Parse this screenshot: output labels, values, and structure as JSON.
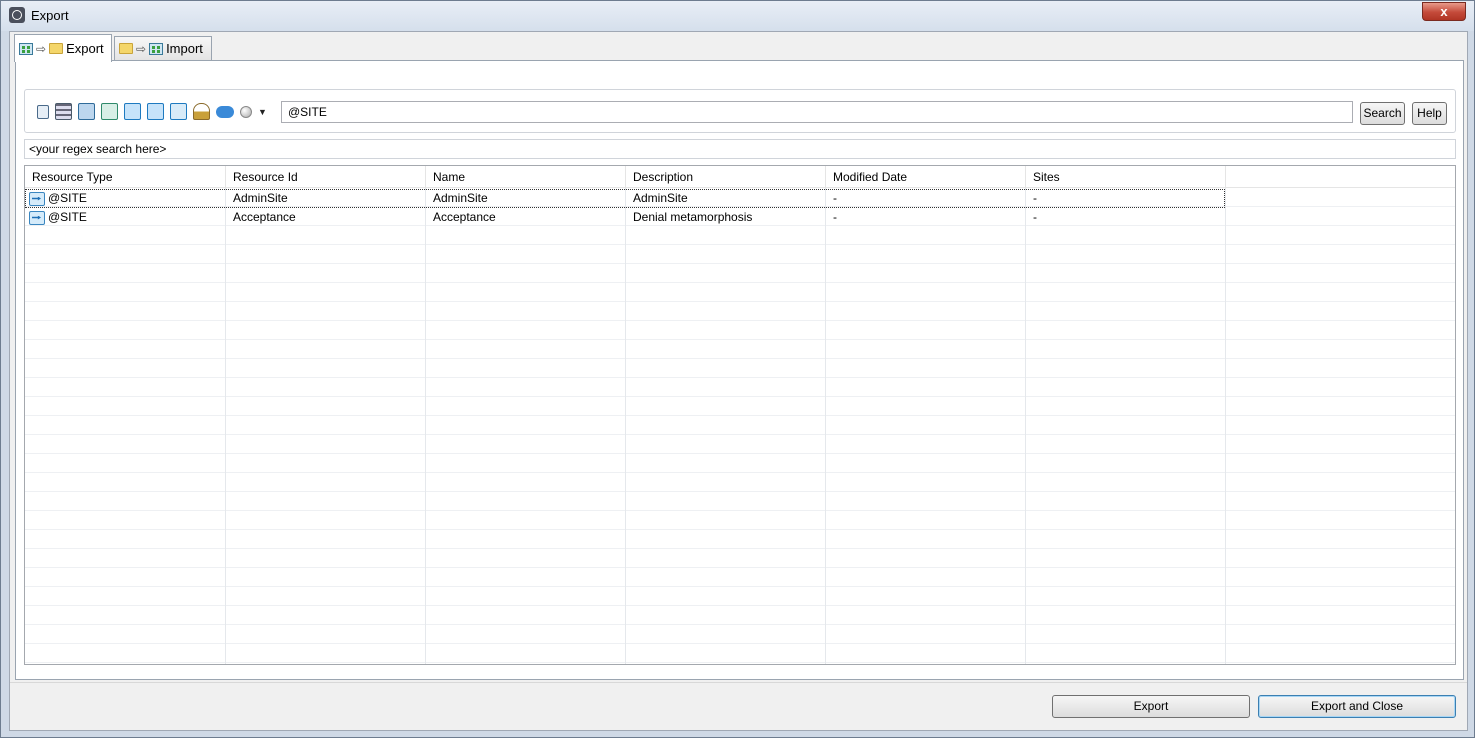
{
  "window": {
    "title": "Export",
    "close_label": "x"
  },
  "tabs": [
    {
      "label": "Export",
      "active": true
    },
    {
      "label": "Import",
      "active": false
    }
  ],
  "search": {
    "toolbar_icons": [
      "script-icon",
      "form-icon",
      "page-icon",
      "attribute-icon",
      "element-catalog-icon",
      "site-catalog-icon",
      "site-icon",
      "user-icon",
      "link-icon",
      "circle-icon"
    ],
    "query_value": "@SITE",
    "search_label": "Search",
    "help_label": "Help"
  },
  "regex": {
    "value": "<your regex search here>"
  },
  "table": {
    "columns": [
      "Resource Type",
      "Resource Id",
      "Name",
      "Description",
      "Modified Date",
      "Sites"
    ],
    "rows": [
      {
        "type": "@SITE",
        "id": "AdminSite",
        "name": "AdminSite",
        "description": "AdminSite",
        "modified": "-",
        "sites": "-"
      },
      {
        "type": "@SITE",
        "id": "Acceptance",
        "name": "Acceptance",
        "description": "Denial metamorphosis",
        "modified": "-",
        "sites": "-"
      }
    ]
  },
  "buttons": {
    "export_label": "Export",
    "export_close_label": "Export and Close"
  }
}
